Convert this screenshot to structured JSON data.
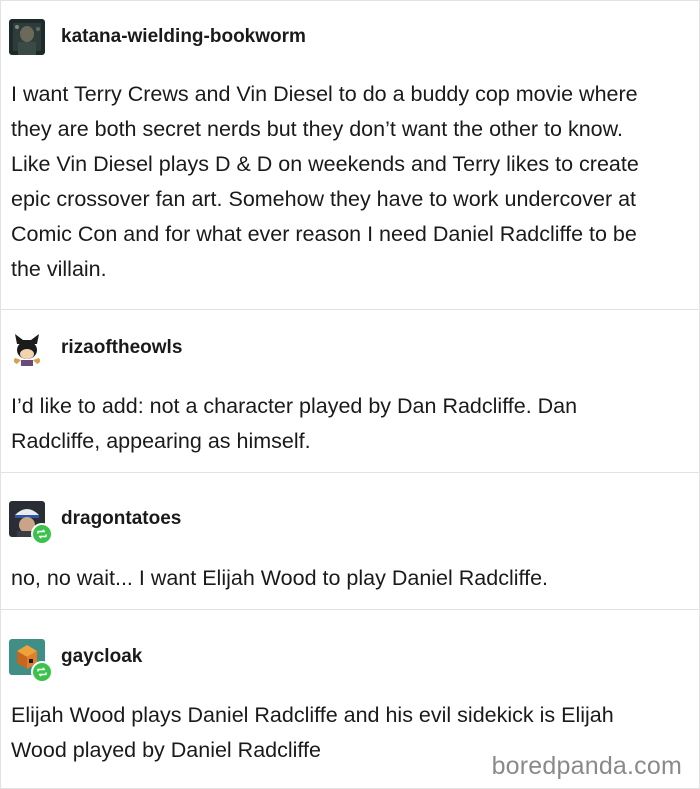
{
  "posts": [
    {
      "username": "katana-wielding-bookworm",
      "avatar_icon": "dark-portrait-avatar",
      "reblog": false,
      "lines": [
        "I want Terry Crews and Vin Diesel to do a buddy cop movie where",
        "they are both secret nerds but they don’t want the other to know.",
        "Like Vin Diesel plays D & D on weekends and Terry likes to create",
        "epic crossover fan art. Somehow they have to work undercover at",
        "Comic Con and for what ever reason I need Daniel Radcliffe to be",
        "the villain."
      ]
    },
    {
      "username": "rizaoftheowls",
      "avatar_icon": "cartoon-character-avatar",
      "reblog": false,
      "lines": [
        "I’d like to add: not a character played by Dan Radcliffe. Dan",
        "Radcliffe, appearing as himself."
      ]
    },
    {
      "username": "dragontatoes",
      "avatar_icon": "person-in-cap-avatar",
      "reblog": true,
      "lines": [
        "no, no wait... I want Elijah Wood to play Daniel Radcliffe."
      ]
    },
    {
      "username": "gaycloak",
      "avatar_icon": "orange-cube-avatar",
      "reblog": true,
      "lines": [
        "Elijah Wood plays Daniel Radcliffe and his evil sidekick is Elijah",
        "Wood played by Daniel Radcliffe"
      ]
    }
  ],
  "watermark": "boredpanda.com",
  "colors": {
    "reblog_badge": "#3bc24a",
    "divider": "#e2e2e2",
    "watermark": "#8a8a8a"
  }
}
